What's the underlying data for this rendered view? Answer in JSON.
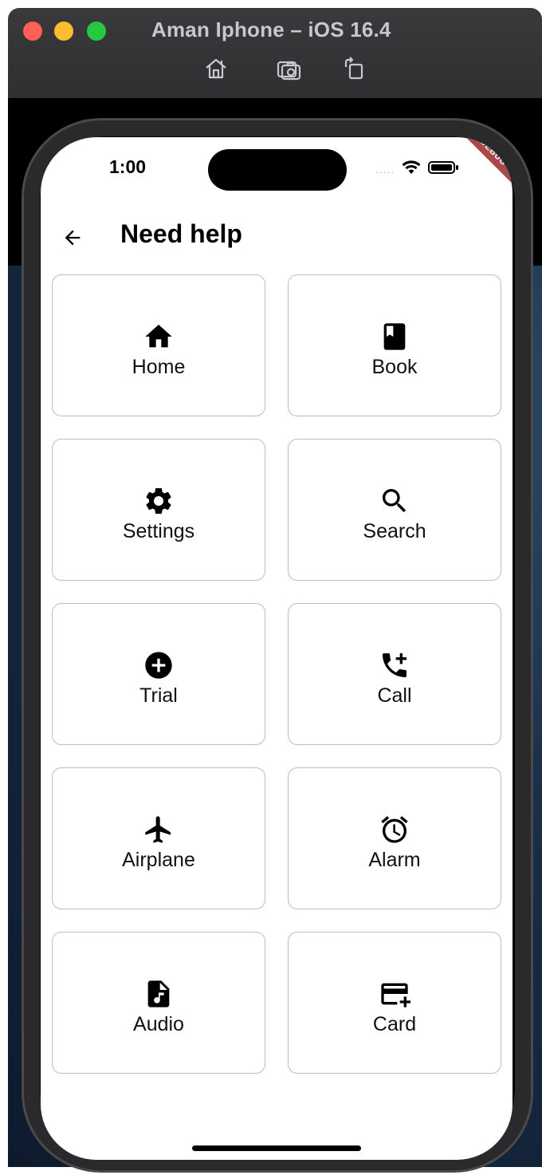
{
  "window": {
    "title": "Aman Iphone – iOS 16.4",
    "toolbar": [
      {
        "icon": "home-icon"
      },
      {
        "icon": "screenshot-icon"
      },
      {
        "icon": "rotate-icon"
      }
    ]
  },
  "status_bar": {
    "time": "1:00",
    "signal": ".....",
    "debug_label": "DEBUG"
  },
  "appbar": {
    "back_icon": "arrow-back-icon",
    "title": "Need help"
  },
  "cards": [
    {
      "label": "Home",
      "icon": "home-icon"
    },
    {
      "label": "Book",
      "icon": "book-icon"
    },
    {
      "label": "Settings",
      "icon": "settings-icon"
    },
    {
      "label": "Search",
      "icon": "search-icon"
    },
    {
      "label": "Trial",
      "icon": "add-circle-icon"
    },
    {
      "label": "Call",
      "icon": "add-call-icon"
    },
    {
      "label": "Airplane",
      "icon": "airplane-icon"
    },
    {
      "label": "Alarm",
      "icon": "alarm-icon"
    },
    {
      "label": "Audio",
      "icon": "audio-file-icon"
    },
    {
      "label": "Card",
      "icon": "add-card-icon"
    }
  ],
  "colors": {
    "debug_banner": "#a94a4a",
    "card_border": "#bdbdbd"
  }
}
